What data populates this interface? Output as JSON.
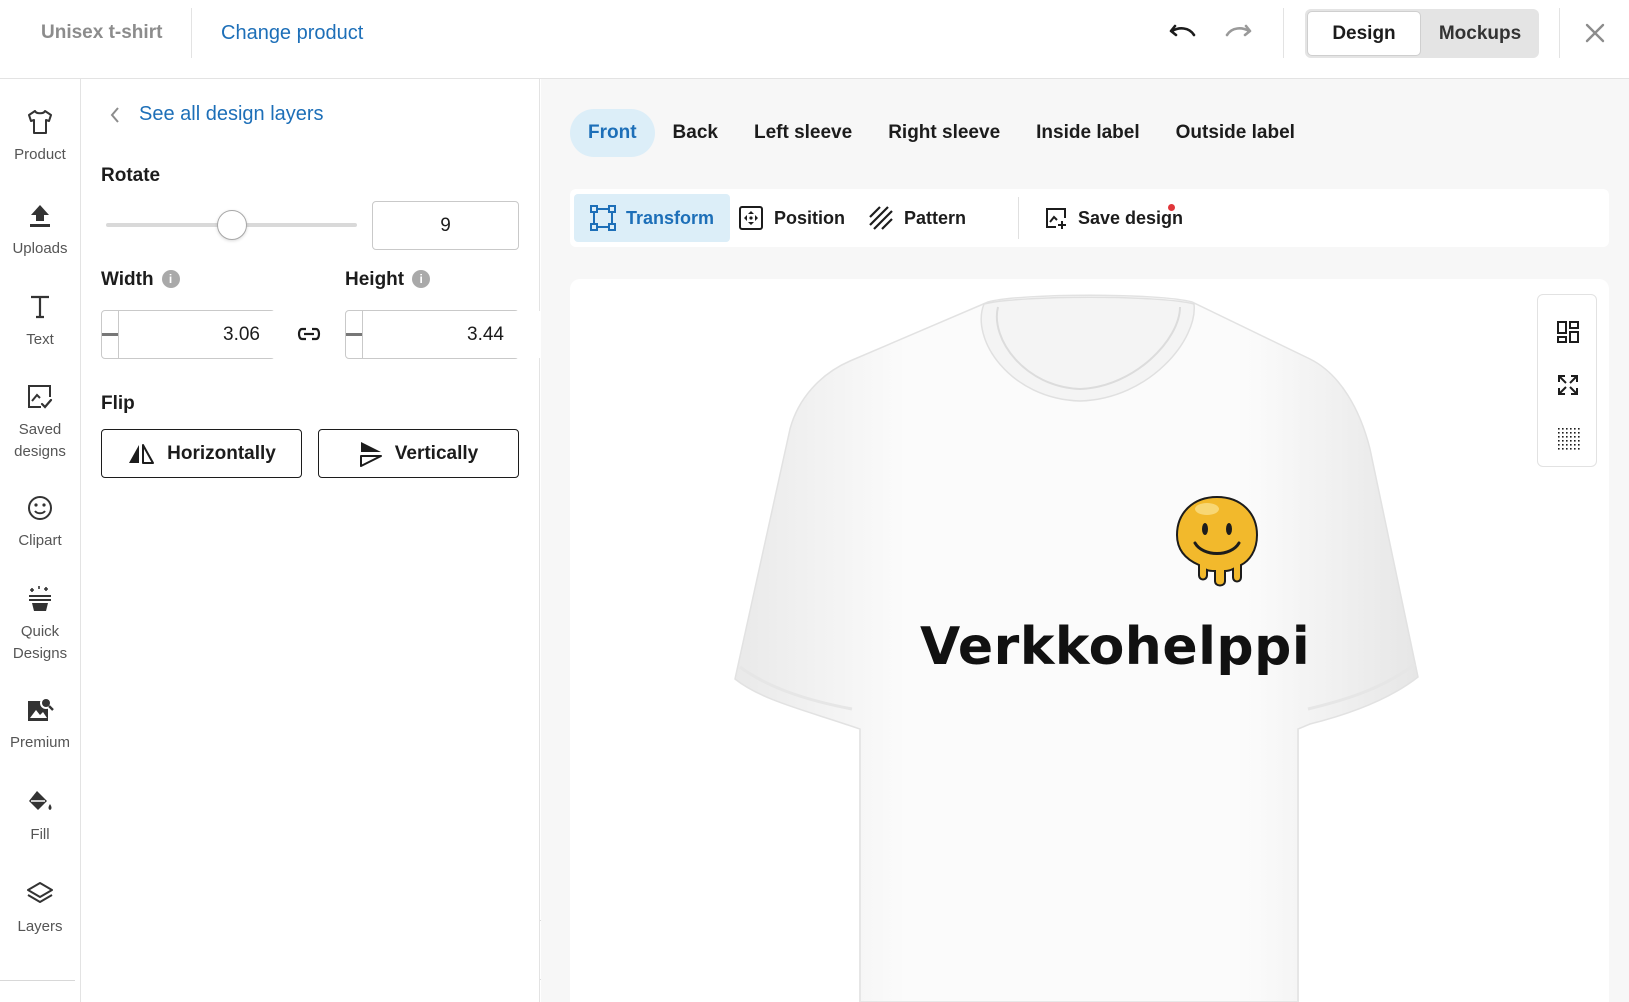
{
  "header": {
    "product_name": "Unisex t-shirt",
    "change_product": "Change product",
    "modes": {
      "design": "Design",
      "mockups": "Mockups",
      "active": "design"
    }
  },
  "rail": {
    "items": [
      {
        "label": "Product",
        "icon": "tshirt-icon"
      },
      {
        "label": "Uploads",
        "icon": "upload-icon"
      },
      {
        "label": "Text",
        "icon": "text-icon"
      },
      {
        "label_line1": "Saved",
        "label_line2": "designs",
        "icon": "saved-designs-icon"
      },
      {
        "label": "Clipart",
        "icon": "smiley-icon"
      },
      {
        "label_line1": "Quick",
        "label_line2": "Designs",
        "icon": "quick-designs-icon"
      },
      {
        "label": "Premium",
        "icon": "premium-image-icon"
      },
      {
        "label": "Fill",
        "icon": "paint-bucket-icon"
      },
      {
        "label": "Layers",
        "icon": "layers-icon"
      }
    ]
  },
  "panel": {
    "back_link": "See all design layers",
    "rotate": {
      "title": "Rotate",
      "value": "9",
      "slider_fraction": 0.5
    },
    "width": {
      "title": "Width",
      "value": "3.06"
    },
    "height": {
      "title": "Height",
      "value": "3.44"
    },
    "flip": {
      "title": "Flip",
      "horizontal": "Horizontally",
      "vertical": "Vertically"
    }
  },
  "placements": {
    "tabs": [
      "Front",
      "Back",
      "Left sleeve",
      "Right sleeve",
      "Inside label",
      "Outside label"
    ],
    "active": "Front"
  },
  "toolbar": {
    "transform": "Transform",
    "position": "Position",
    "pattern": "Pattern",
    "save_design": "Save design"
  },
  "canvas": {
    "design_text": "Verkkohelppi",
    "graphic": "melting-smiley",
    "colors": {
      "smiley_yellow": "#f2b92c",
      "shirt": "#ffffff",
      "accent": "#1d6fb8",
      "active_tab_bg": "#dceef8",
      "notification": "#e0363a"
    }
  }
}
